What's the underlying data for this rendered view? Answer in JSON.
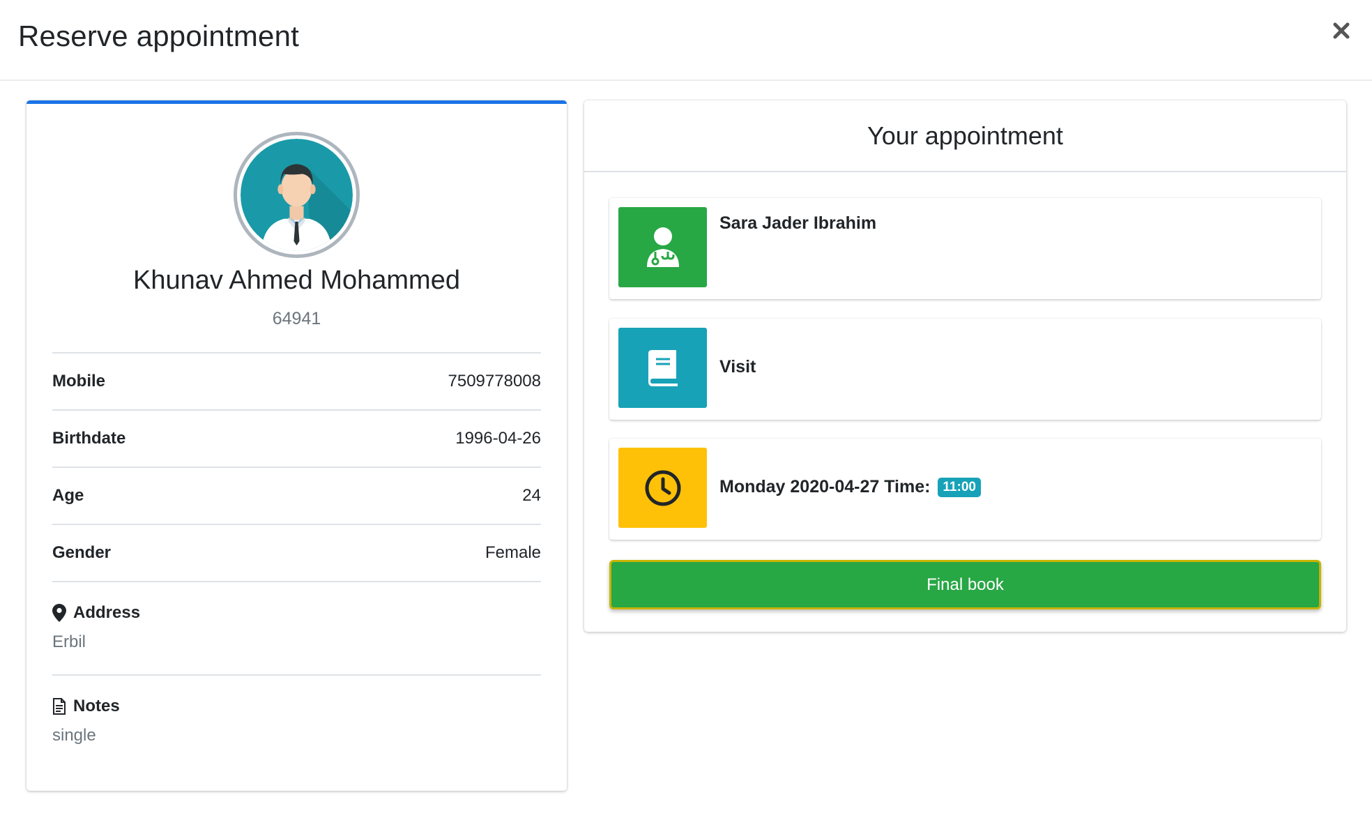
{
  "modal": {
    "title": "Reserve appointment",
    "close_icon": "close-icon"
  },
  "patient": {
    "name": "Khunav Ahmed Mohammed",
    "id": "64941",
    "avatar_icon": "doctor-avatar-icon",
    "fields": [
      {
        "label": "Mobile",
        "value": "7509778008"
      },
      {
        "label": "Birthdate",
        "value": "1996-04-26"
      },
      {
        "label": "Age",
        "value": "24"
      },
      {
        "label": "Gender",
        "value": "Female"
      }
    ],
    "address": {
      "label": "Address",
      "value": "Erbil",
      "icon": "map-marker-icon"
    },
    "notes": {
      "label": "Notes",
      "value": "single",
      "icon": "file-text-icon"
    }
  },
  "appointment": {
    "header": "Your appointment",
    "doctor": {
      "name": "Sara Jader Ibrahim",
      "icon": "user-md-icon",
      "color": "#28a745"
    },
    "service": {
      "name": "Visit",
      "icon": "book-icon",
      "color": "#17a2b8"
    },
    "datetime": {
      "text": "Monday 2020-04-27 Time:",
      "time": "11:00",
      "icon": "clock-icon",
      "color": "#ffc107"
    },
    "final_button": "Final book"
  },
  "colors": {
    "accent_blue": "#1a73e8",
    "success": "#28a745",
    "info": "#17a2b8",
    "warning": "#ffc107"
  }
}
